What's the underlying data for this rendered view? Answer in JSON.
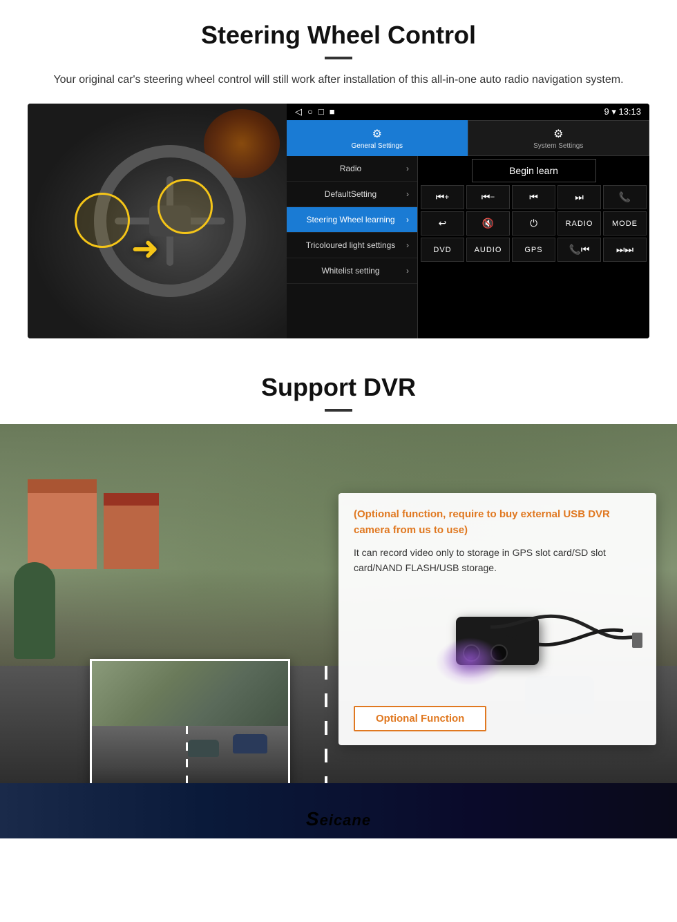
{
  "steering": {
    "title": "Steering Wheel Control",
    "subtitle": "Your original car's steering wheel control will still work after installation of this all-in-one auto radio navigation system.",
    "android_ui": {
      "statusbar": {
        "icons": [
          "◁",
          "○",
          "□",
          "■"
        ],
        "right": "9 ▾ 13:13"
      },
      "tabs": [
        {
          "label": "General Settings",
          "icon": "⚙",
          "active": true
        },
        {
          "label": "System Settings",
          "icon": "🔧",
          "active": false
        }
      ],
      "menu_items": [
        {
          "label": "Radio",
          "active": false
        },
        {
          "label": "DefaultSetting",
          "active": false
        },
        {
          "label": "Steering Wheel learning",
          "active": true
        },
        {
          "label": "Tricoloured light settings",
          "active": false
        },
        {
          "label": "Whitelist setting",
          "active": false
        }
      ],
      "begin_learn": "Begin learn",
      "control_buttons": [
        "⏮+",
        "⏮−",
        "⏮⏮",
        "⏭⏭",
        "☎",
        "↩",
        "🔇×",
        "⏻",
        "RADIO",
        "MODE",
        "DVD",
        "AUDIO",
        "GPS",
        "📞⏮",
        "⏭⏭"
      ]
    }
  },
  "dvr": {
    "title": "Support DVR",
    "optional_text": "(Optional function, require to buy external USB DVR camera from us to use)",
    "description": "It can record video only to storage in GPS slot card/SD slot card/NAND FLASH/USB storage.",
    "optional_function_btn": "Optional Function",
    "brand": "Seicane"
  }
}
